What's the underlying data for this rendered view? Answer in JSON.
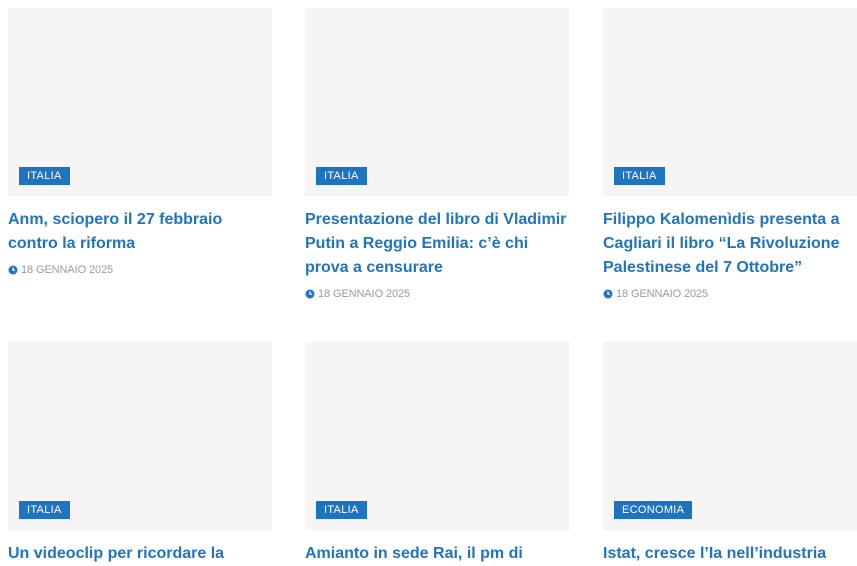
{
  "colors": {
    "accent": "#1f74c2",
    "thumb_bg": "#f5f5f5",
    "meta": "#9a9a9a"
  },
  "icons": {
    "date": "clock-icon"
  },
  "articles": [
    {
      "category": "ITALIA",
      "title": "Anm, sciopero il 27 febbraio contro la riforma",
      "date": "18 GENNAIO 2025"
    },
    {
      "category": "ITALIA",
      "title": "Presentazione del libro di Vladimir Putin a Reggio Emilia: c’è chi prova a censurare",
      "date": "18 GENNAIO 2025"
    },
    {
      "category": "ITALIA",
      "title": "Filippo Kalomenìdis presenta a Cagliari il libro “La Rivoluzione Palestinese del 7 Ottobre”",
      "date": "18 GENNAIO 2025"
    },
    {
      "category": "ITALIA",
      "title": "Un videoclip per ricordare la"
    },
    {
      "category": "ITALIA",
      "title": "Amianto in sede Rai, il pm di"
    },
    {
      "category": "ECONOMIA",
      "title": "Istat, cresce l’Ia nell’industria"
    }
  ]
}
